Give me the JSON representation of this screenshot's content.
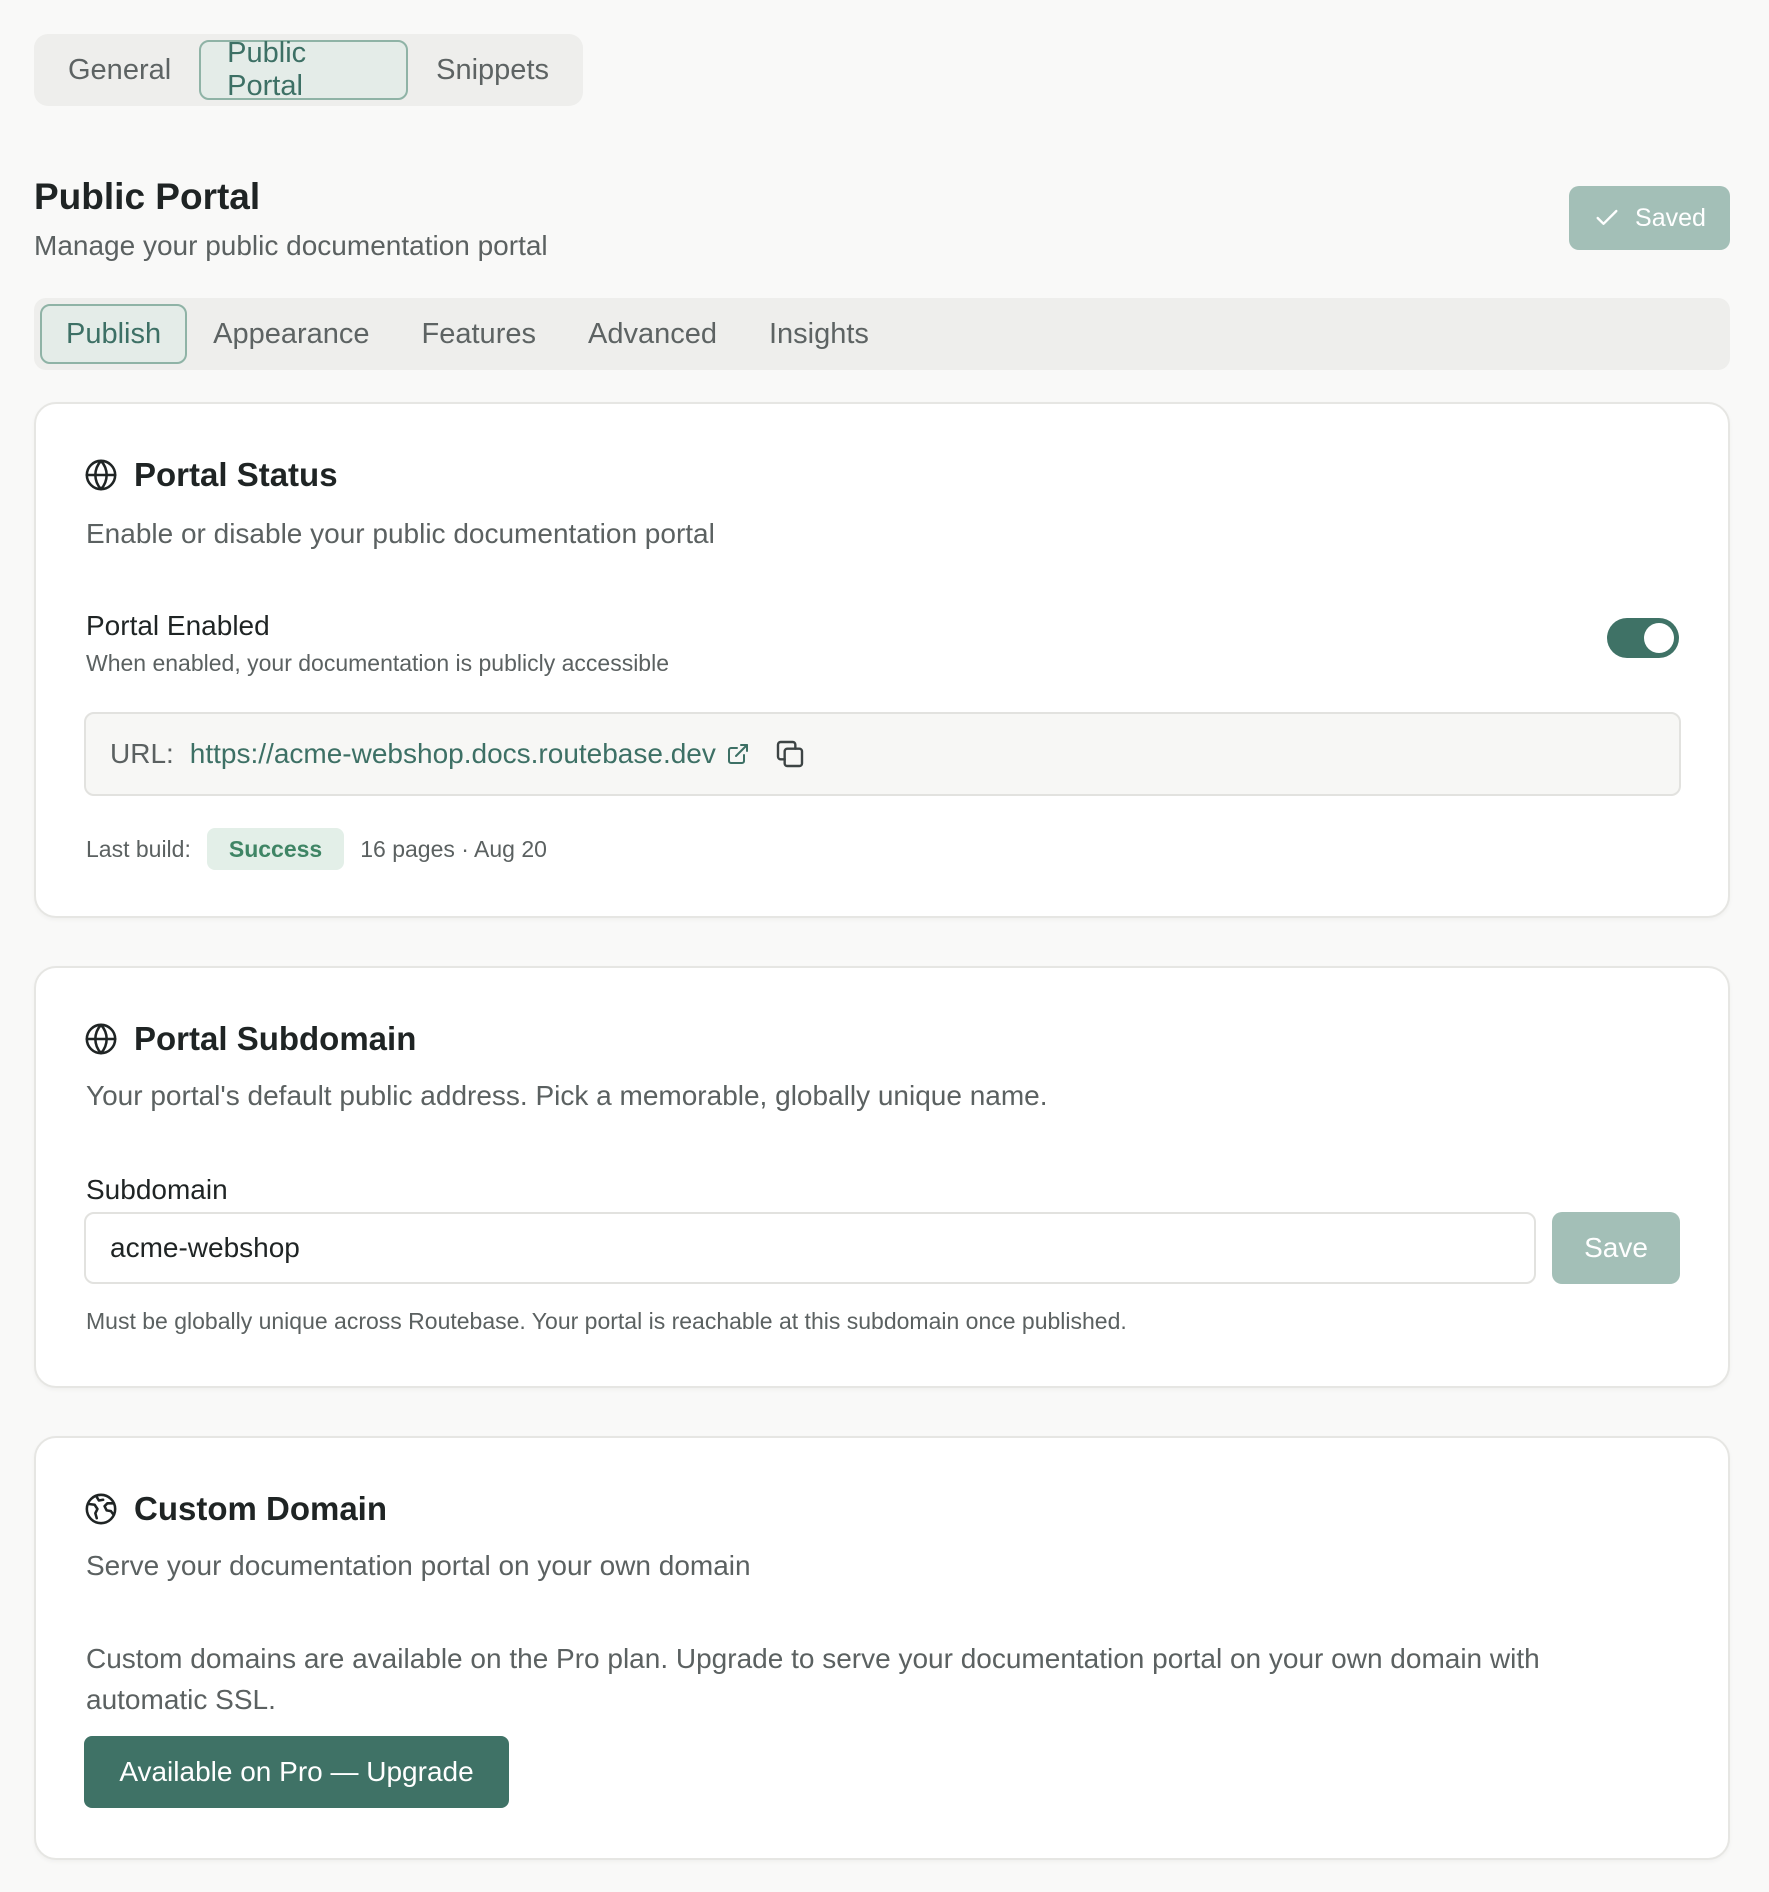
{
  "top_tabs": [
    {
      "label": "General",
      "active": false
    },
    {
      "label": "Public Portal",
      "active": true
    },
    {
      "label": "Snippets",
      "active": false
    }
  ],
  "header": {
    "title": "Public Portal",
    "subtitle": "Manage your public documentation portal",
    "saved_label": "Saved"
  },
  "sub_tabs": [
    {
      "label": "Publish",
      "active": true
    },
    {
      "label": "Appearance",
      "active": false
    },
    {
      "label": "Features",
      "active": false
    },
    {
      "label": "Advanced",
      "active": false
    },
    {
      "label": "Insights",
      "active": false
    }
  ],
  "portal_status": {
    "title": "Portal Status",
    "icon": "globe-icon",
    "description": "Enable or disable your public documentation portal",
    "toggle_label": "Portal Enabled",
    "toggle_help": "When enabled, your documentation is publicly accessible",
    "enabled": true,
    "url_label": "URL:",
    "url": "https://acme-webshop.docs.routebase.dev",
    "build_label": "Last build:",
    "build_status": "Success",
    "build_meta": "16 pages · Aug 20"
  },
  "portal_subdomain": {
    "title": "Portal Subdomain",
    "icon": "globe-icon",
    "description": "Your portal's default public address. Pick a memorable, globally unique name.",
    "field_label": "Subdomain",
    "value": "acme-webshop",
    "save_label": "Save",
    "help": "Must be globally unique across Routebase. Your portal is reachable at this subdomain once published."
  },
  "custom_domain": {
    "title": "Custom Domain",
    "icon": "earth-icon",
    "description": "Serve your documentation portal on your own domain",
    "promo": "Custom domains are available on the Pro plan. Upgrade to serve your documentation portal on your own domain with automatic SSL.",
    "upgrade_label": "Available on Pro — Upgrade"
  },
  "colors": {
    "accent": "#3f7266",
    "accent_light": "#a3bfb7",
    "success": "#3f8565",
    "background": "#f9f9f8"
  }
}
